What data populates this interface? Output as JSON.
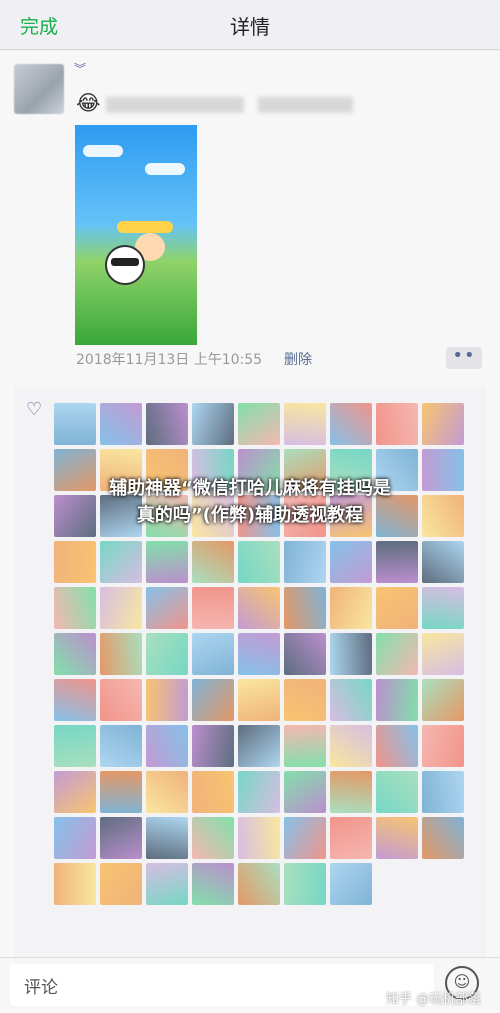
{
  "nav": {
    "back_label": "完成",
    "title": "详情"
  },
  "post": {
    "fold_icon": "chevron-down-icon",
    "emoji": "😂",
    "timestamp": "2018年11月13日 上午10:55",
    "delete_label": "删除",
    "more_label": "••"
  },
  "likes": {
    "icon": "heart-outline-icon",
    "count": 97
  },
  "overlay": {
    "line1": "辅助神器“微信打哈儿麻将有挂吗是",
    "line2": "真的吗”(作弊)辅助透视教程"
  },
  "comment": {
    "placeholder": "评论",
    "icon": "smile-emoji-icon"
  },
  "watermark": "知乎 @玩机部落",
  "colors": {
    "link": "#576b95",
    "accent": "#17b04a"
  }
}
